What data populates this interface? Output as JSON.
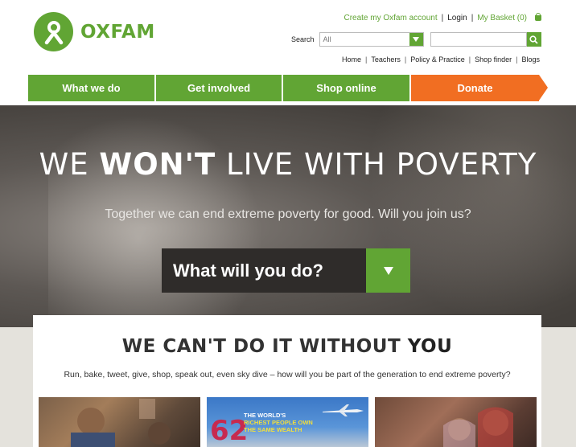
{
  "brand": {
    "name": "OXFAM",
    "color": "#61a534",
    "accent": "#f16e22"
  },
  "top_links": {
    "create_account": "Create my Oxfam account",
    "login": "Login",
    "basket": "My Basket (0)"
  },
  "search": {
    "label": "Search",
    "category": "All",
    "placeholder": ""
  },
  "sub_links": [
    "Home",
    "Teachers",
    "Policy & Practice",
    "Shop finder",
    "Blogs"
  ],
  "nav": [
    "What we do",
    "Get involved",
    "Shop online",
    "Donate"
  ],
  "hero": {
    "title_pre": "WE ",
    "title_bold": "WON'T",
    "title_post": " LIVE WITH POVERTY",
    "subtitle": "Together we can end extreme poverty for good. Will you join us?",
    "cta": "What will you do?"
  },
  "panel": {
    "title_pre": "WE CAN'T DO IT WITHOUT ",
    "title_bold": "YOU",
    "subtitle": "Run, bake, tweet, give, shop, speak out, even sky dive – how will you be part of the generation to end extreme poverty?",
    "thumb2_line1": "THE WORLD'S",
    "thumb2_line2": "RICHEST PEOPLE OWN",
    "thumb2_line3": "THE SAME WEALTH",
    "thumb2_number": "62"
  }
}
